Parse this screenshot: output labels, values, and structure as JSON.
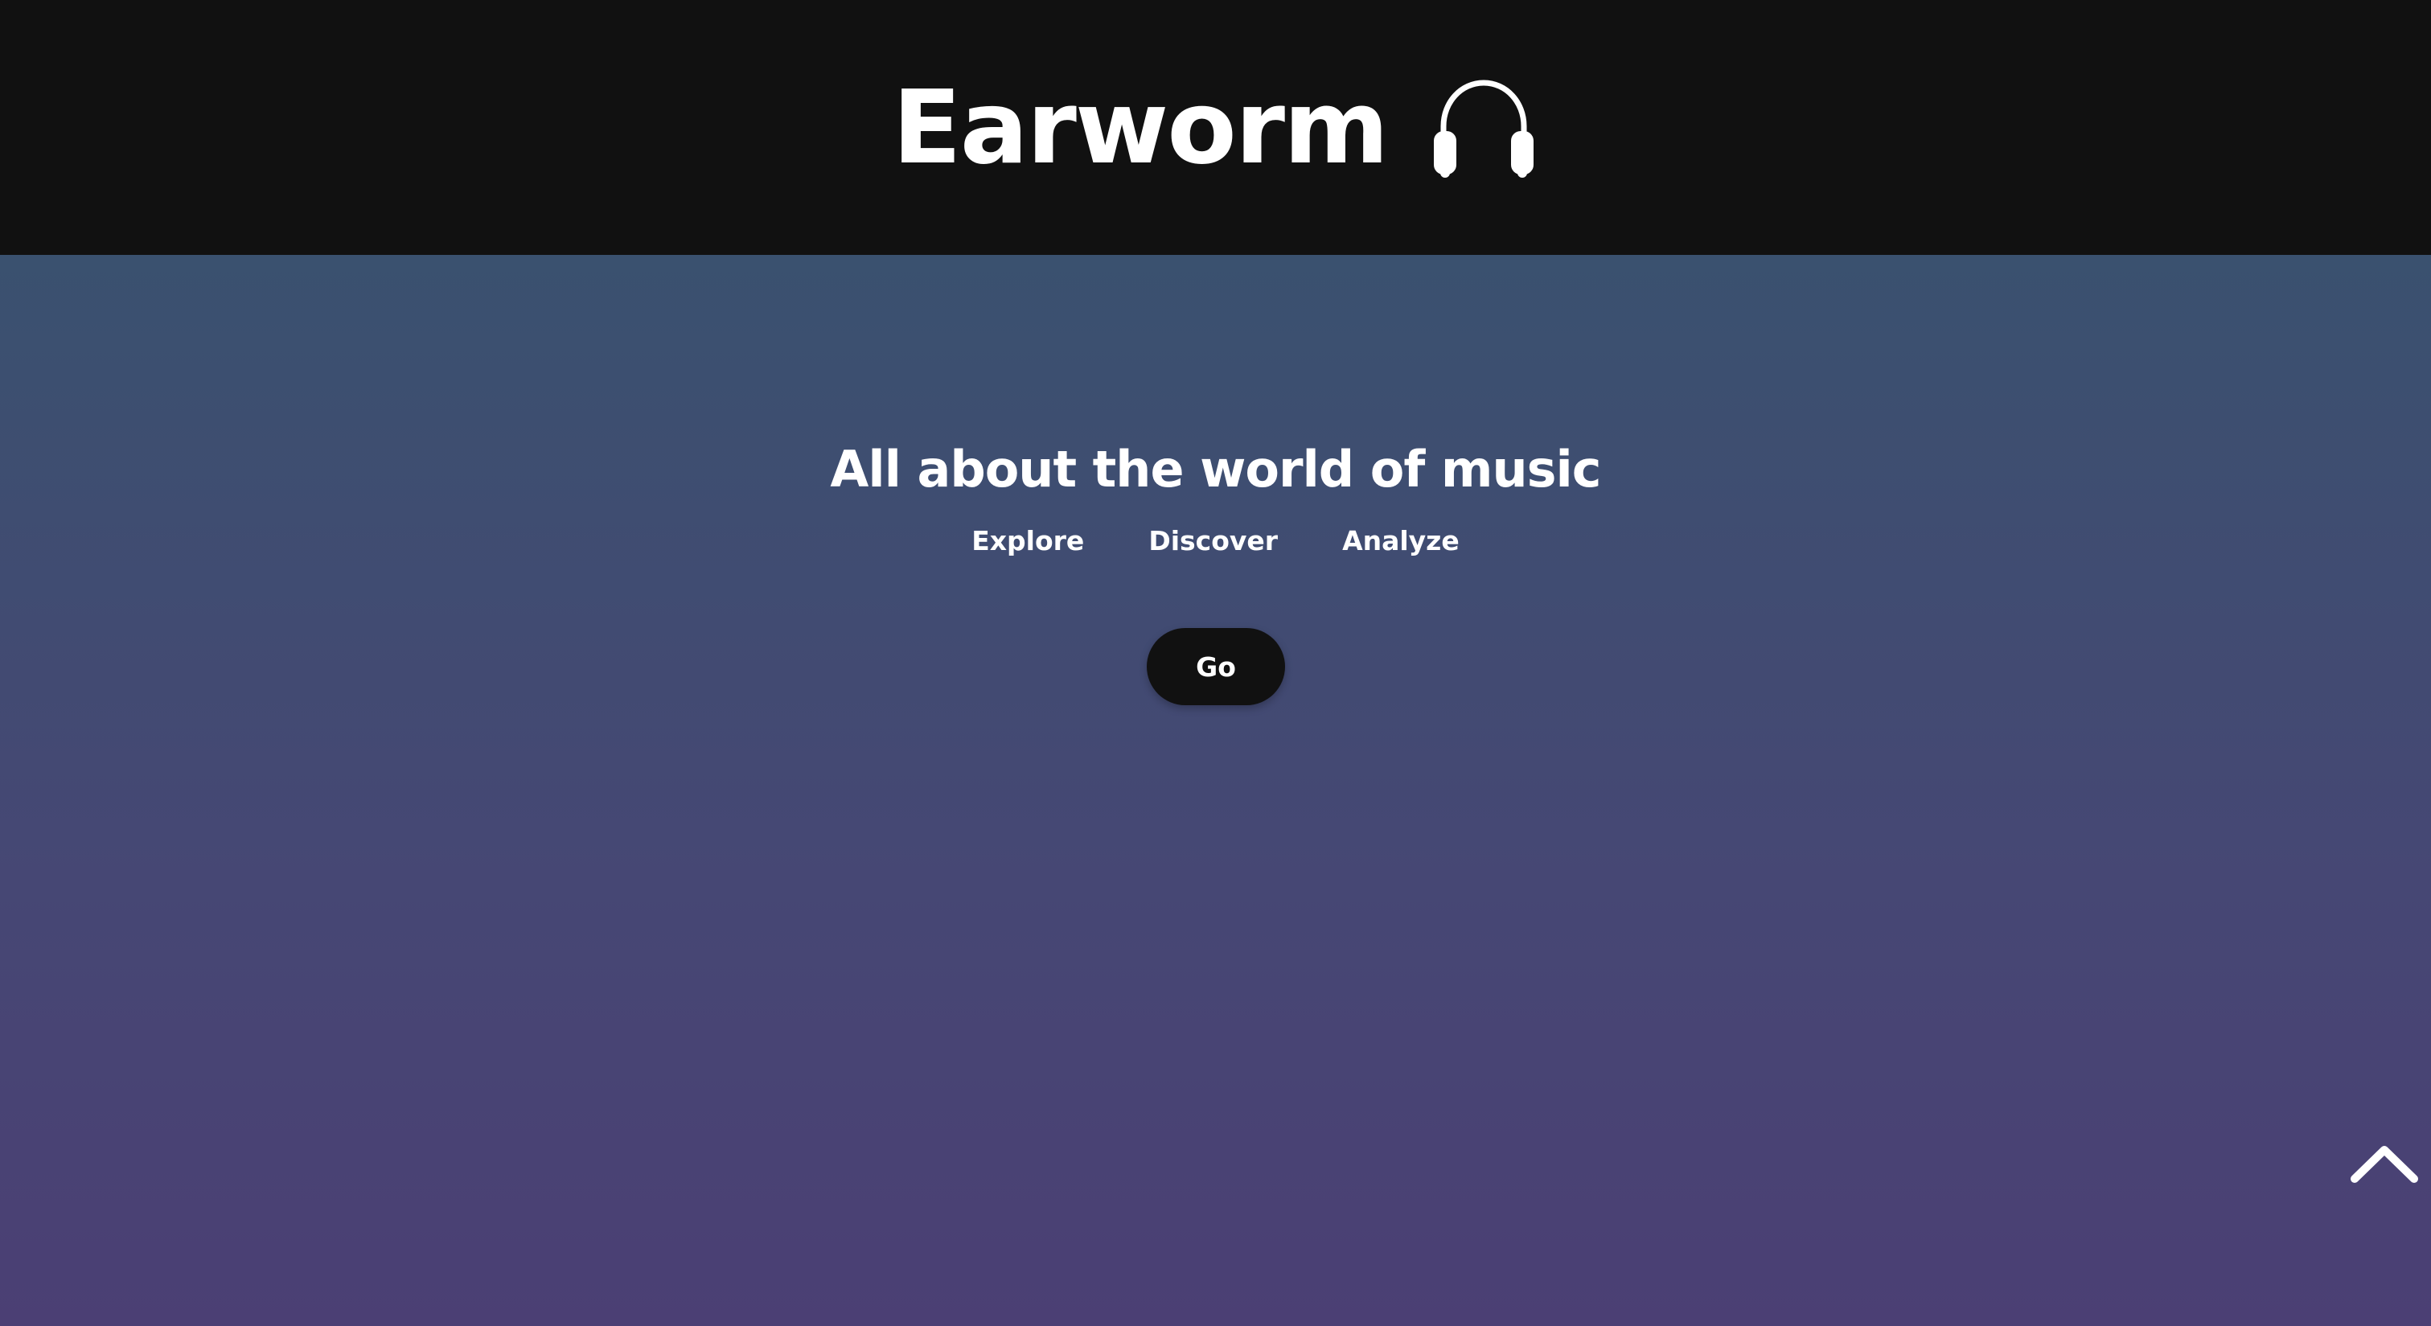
{
  "header": {
    "title": "Earworm",
    "icon": "headphones-icon",
    "background": "#111111"
  },
  "hero": {
    "tagline": "All about the world of music",
    "nav": [
      {
        "label": "Explore"
      },
      {
        "label": "Discover"
      },
      {
        "label": "Analyze"
      }
    ],
    "cta_label": "Go",
    "gradient": {
      "top": "#3a516f",
      "bottom": "#4b3f74"
    }
  },
  "scroll_top": {
    "icon": "chevron-up-icon"
  }
}
